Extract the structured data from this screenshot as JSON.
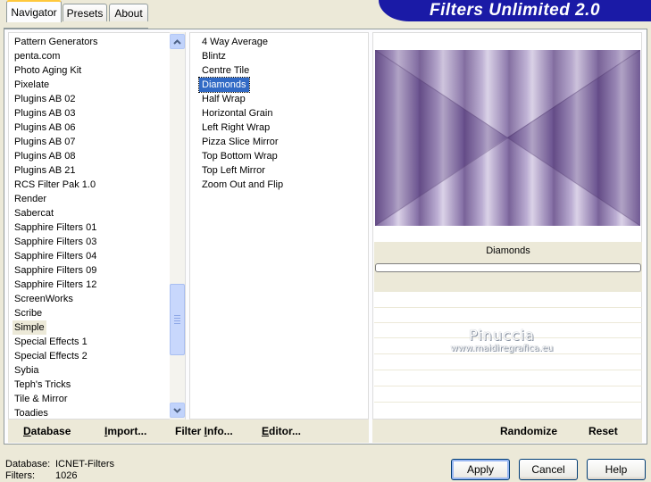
{
  "app": {
    "title": "Filters Unlimited 2.0"
  },
  "tabs": [
    {
      "label": "Navigator"
    },
    {
      "label": "Presets"
    },
    {
      "label": "About"
    }
  ],
  "categories": {
    "items": [
      "Pattern Generators",
      "penta.com",
      "Photo Aging Kit",
      "Pixelate",
      "Plugins AB 02",
      "Plugins AB 03",
      "Plugins AB 06",
      "Plugins AB 07",
      "Plugins AB 08",
      "Plugins AB 21",
      "RCS Filter Pak 1.0",
      "Render",
      "Sabercat",
      "Sapphire Filters 01",
      "Sapphire Filters 03",
      "Sapphire Filters 04",
      "Sapphire Filters 09",
      "Sapphire Filters 12",
      "ScreenWorks",
      "Scribe",
      "Simple",
      "Special Effects 1",
      "Special Effects 2",
      "Sybia",
      "Teph's Tricks",
      "Tile & Mirror",
      "Toadies"
    ],
    "selected_index": 20
  },
  "filters": {
    "items": [
      "4 Way Average",
      "Blintz",
      "Centre Tile",
      "Diamonds",
      "Half Wrap",
      "Horizontal Grain",
      "Left Right Wrap",
      "Pizza Slice Mirror",
      "Top Bottom Wrap",
      "Top Left Mirror",
      "Zoom Out and Flip"
    ],
    "selected_index": 3
  },
  "preview": {
    "filter_name": "Diamonds",
    "colors": {
      "dark": "#6e5690",
      "light": "#d8cfe6"
    }
  },
  "watermark": {
    "line1": "Pinuccia",
    "line2": "www.maidiregrafica.eu"
  },
  "left_buttons": {
    "database": {
      "u": "D",
      "rest": "atabase"
    },
    "import": {
      "u": "I",
      "rest": "mport..."
    },
    "filter_info": {
      "pre": "Filter ",
      "u": "I",
      "rest": "nfo..."
    },
    "editor": {
      "u": "E",
      "rest": "ditor..."
    }
  },
  "right_buttons": {
    "randomize": "Randomize",
    "reset": "Reset"
  },
  "status": {
    "database_label": "Database:",
    "database_value": "ICNET-Filters",
    "filters_label": "Filters:",
    "filters_value": "1026"
  },
  "dialog": {
    "apply": "Apply",
    "cancel": "Cancel",
    "help": "Help"
  },
  "colors": {
    "banner": "#1a1aa6",
    "selection": "#316ac5",
    "face": "#ece9d8"
  }
}
